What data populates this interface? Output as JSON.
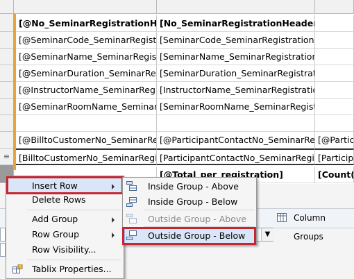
{
  "grid": {
    "rows": [
      {
        "c1": "[@No_SeminarRegistrationHeader]",
        "c2": "[No_SeminarRegistrationHeader]",
        "c3": "",
        "bold": true
      },
      {
        "c1": "[@SeminarCode_SeminarRegistrationHeader]",
        "c2": "[SeminarCode_SeminarRegistrationHeader]",
        "c3": ""
      },
      {
        "c1": "[@SeminarName_SeminarRegistrationHeader]",
        "c2": "[SeminarName_SeminarRegistrationHeader]",
        "c3": ""
      },
      {
        "c1": "[@SeminarDuration_SeminarRegistrationHeader]",
        "c2": "[SeminarDuration_SeminarRegistrationHeader]",
        "c3": ""
      },
      {
        "c1": "[@InstructorName_SeminarRegistrationHeader]",
        "c2": "[InstructorName_SeminarRegistrationHeader]",
        "c3": ""
      },
      {
        "c1": "[@SeminarRoomName_SeminarRegistrationHeader]",
        "c2": "[SeminarRoomName_SeminarRegistrationHeader]",
        "c3": ""
      },
      {
        "c1": "",
        "c2": "",
        "c3": ""
      },
      {
        "c1": "[@BilltoCustomerNo_SeminarRegistrationLine]",
        "c2": "[@ParticipantContactNo_SeminarRegistrationLine]",
        "c3": "[@ParticipantName]"
      },
      {
        "c1": "[BilltoCustomerNo_SeminarRegistrationLine]",
        "c2": "[ParticipantContactNo_SeminarRegistrationLine]",
        "c3": "[ParticipantName]"
      },
      {
        "c1": "",
        "c2": "[@Total_per_registration]",
        "c3": "[Count(ParticipantName)]",
        "bold": true
      }
    ]
  },
  "context_menu": {
    "items": {
      "insert_row": "Insert Row",
      "delete_rows": "Delete Rows",
      "add_group": "Add Group",
      "row_group": "Row Group",
      "row_visibility": "Row Visibility...",
      "tablix_properties": "Tablix Properties..."
    }
  },
  "submenu": {
    "items": {
      "inside_above": "Inside Group - Above",
      "inside_below": "Inside Group - Below",
      "outside_above": "Outside Group - Above",
      "outside_below": "Outside Group - Below"
    }
  },
  "groups_bar": {
    "column_groups_label": "Column Groups"
  },
  "colors": {
    "group_marker": "#e8a33b",
    "highlight_box": "#c72630",
    "hover_fill": "#d9e6f7"
  }
}
